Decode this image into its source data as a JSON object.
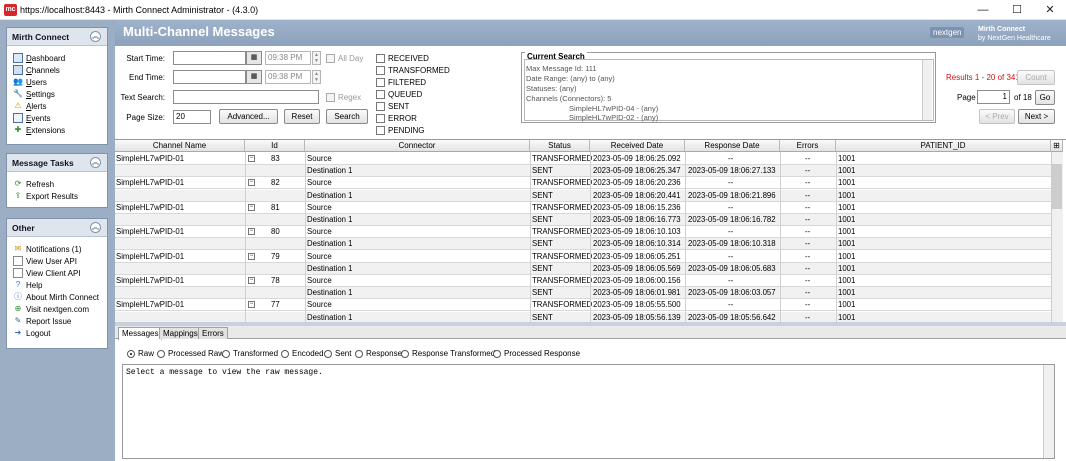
{
  "window": {
    "icon_text": "mc",
    "title": "https://localhost:8443 - Mirth Connect Administrator - (4.3.0)",
    "minimize": "—",
    "maximize": "☐",
    "close": "✕"
  },
  "sidebar": {
    "mirth_connect": {
      "title": "Mirth Connect",
      "items": [
        {
          "label": "Dashboard",
          "icon": "dashboard-icon"
        },
        {
          "label": "Channels",
          "icon": "channels-icon"
        },
        {
          "label": "Users",
          "icon": "users-icon"
        },
        {
          "label": "Settings",
          "icon": "settings-icon"
        },
        {
          "label": "Alerts",
          "icon": "alerts-icon"
        },
        {
          "label": "Events",
          "icon": "events-icon"
        },
        {
          "label": "Extensions",
          "icon": "extensions-icon"
        }
      ]
    },
    "message_tasks": {
      "title": "Message Tasks",
      "items": [
        {
          "label": "Refresh",
          "icon": "refresh-icon"
        },
        {
          "label": "Export Results",
          "icon": "export-icon"
        }
      ]
    },
    "other": {
      "title": "Other",
      "items": [
        {
          "label": "Notifications (1)",
          "icon": "notifications-icon"
        },
        {
          "label": "View User API",
          "icon": "document-icon"
        },
        {
          "label": "View Client API",
          "icon": "document-icon"
        },
        {
          "label": "Help",
          "icon": "help-icon"
        },
        {
          "label": "About Mirth Connect",
          "icon": "info-icon"
        },
        {
          "label": "Visit nextgen.com",
          "icon": "globe-icon"
        },
        {
          "label": "Report Issue",
          "icon": "report-icon"
        },
        {
          "label": "Logout",
          "icon": "logout-icon"
        }
      ]
    }
  },
  "header": {
    "title": "Multi-Channel Messages",
    "brand_logo": "nextgen",
    "brand_line1": "Mirth Connect",
    "brand_line2": "by NextGen Healthcare"
  },
  "filters": {
    "start_time_label": "Start Time:",
    "end_time_label": "End Time:",
    "text_search_label": "Text Search:",
    "page_size_label": "Page Size:",
    "start_time_value": "",
    "end_time_value": "",
    "start_clock": "09:38 PM",
    "end_clock": "09:38 PM",
    "all_day": "All Day",
    "regex": "Regex",
    "text_search_value": "",
    "page_size_value": "20",
    "advanced_button": "Advanced...",
    "reset_button": "Reset",
    "search_button": "Search",
    "statuses": [
      "RECEIVED",
      "TRANSFORMED",
      "FILTERED",
      "QUEUED",
      "SENT",
      "ERROR",
      "PENDING"
    ]
  },
  "current_search": {
    "title": "Current Search",
    "lines": [
      "Max Message Id: 111",
      "Date Range: (any) to (any)",
      "Statuses: (any)",
      "Channels (Connectors): 5",
      "SimpleHL7wPID-04 - (any)",
      "SimpleHL7wPID-02 - (any)"
    ]
  },
  "results": {
    "text": "Results 1 - 20 of 341",
    "count_button": "Count",
    "page_label": "Page",
    "page_value": "1",
    "of_label": "of 18",
    "go_button": "Go",
    "prev_button": "< Prev",
    "next_button": "Next >"
  },
  "table": {
    "columns": [
      "Channel Name",
      "Id",
      "Connector",
      "Status",
      "Received Date",
      "Response Date",
      "Errors",
      "PATIENT_ID"
    ],
    "rows": [
      {
        "channel": "SimpleHL7wPID-01",
        "id": "83",
        "connector": "Source",
        "status": "TRANSFORMED",
        "received": "2023-05-09 18:06:25.092",
        "response": "--",
        "errors": "--",
        "patient": "1001"
      },
      {
        "channel": "",
        "id": "",
        "connector": "Destination 1",
        "status": "SENT",
        "received": "2023-05-09 18:06:25.347",
        "response": "2023-05-09 18:06:27.133",
        "errors": "--",
        "patient": "1001"
      },
      {
        "channel": "SimpleHL7wPID-01",
        "id": "82",
        "connector": "Source",
        "status": "TRANSFORMED",
        "received": "2023-05-09 18:06:20.236",
        "response": "--",
        "errors": "--",
        "patient": "1001"
      },
      {
        "channel": "",
        "id": "",
        "connector": "Destination 1",
        "status": "SENT",
        "received": "2023-05-09 18:06:20.441",
        "response": "2023-05-09 18:06:21.896",
        "errors": "--",
        "patient": "1001"
      },
      {
        "channel": "SimpleHL7wPID-01",
        "id": "81",
        "connector": "Source",
        "status": "TRANSFORMED",
        "received": "2023-05-09 18:06:15.236",
        "response": "--",
        "errors": "--",
        "patient": "1001"
      },
      {
        "channel": "",
        "id": "",
        "connector": "Destination 1",
        "status": "SENT",
        "received": "2023-05-09 18:06:16.773",
        "response": "2023-05-09 18:06:16.782",
        "errors": "--",
        "patient": "1001"
      },
      {
        "channel": "SimpleHL7wPID-01",
        "id": "80",
        "connector": "Source",
        "status": "TRANSFORMED",
        "received": "2023-05-09 18:06:10.103",
        "response": "--",
        "errors": "--",
        "patient": "1001"
      },
      {
        "channel": "",
        "id": "",
        "connector": "Destination 1",
        "status": "SENT",
        "received": "2023-05-09 18:06:10.314",
        "response": "2023-05-09 18:06:10.318",
        "errors": "--",
        "patient": "1001"
      },
      {
        "channel": "SimpleHL7wPID-01",
        "id": "79",
        "connector": "Source",
        "status": "TRANSFORMED",
        "received": "2023-05-09 18:06:05.251",
        "response": "--",
        "errors": "--",
        "patient": "1001"
      },
      {
        "channel": "",
        "id": "",
        "connector": "Destination 1",
        "status": "SENT",
        "received": "2023-05-09 18:06:05.569",
        "response": "2023-05-09 18:06:05.683",
        "errors": "--",
        "patient": "1001"
      },
      {
        "channel": "SimpleHL7wPID-01",
        "id": "78",
        "connector": "Source",
        "status": "TRANSFORMED",
        "received": "2023-05-09 18:06:00.156",
        "response": "--",
        "errors": "--",
        "patient": "1001"
      },
      {
        "channel": "",
        "id": "",
        "connector": "Destination 1",
        "status": "SENT",
        "received": "2023-05-09 18:06:01.981",
        "response": "2023-05-09 18:06:03.057",
        "errors": "--",
        "patient": "1001"
      },
      {
        "channel": "SimpleHL7wPID-01",
        "id": "77",
        "connector": "Source",
        "status": "TRANSFORMED",
        "received": "2023-05-09 18:05:55.500",
        "response": "--",
        "errors": "--",
        "patient": "1001"
      },
      {
        "channel": "",
        "id": "",
        "connector": "Destination 1",
        "status": "SENT",
        "received": "2023-05-09 18:05:56.139",
        "response": "2023-05-09 18:05:56.642",
        "errors": "--",
        "patient": "1001"
      }
    ]
  },
  "bottom": {
    "tabs": [
      "Messages",
      "Mappings",
      "Errors"
    ],
    "radio_options": [
      "Raw",
      "Processed Raw",
      "Transformed",
      "Encoded",
      "Sent",
      "Response",
      "Response Transformed",
      "Processed Response"
    ],
    "selected": "Raw",
    "raw_text": "Select a message to view the raw message."
  },
  "colors": {
    "sidebar_bg": "#9caec3",
    "header_bg": "#8da2bc",
    "results_text": "#d01010",
    "app_icon": "#d9262c"
  }
}
